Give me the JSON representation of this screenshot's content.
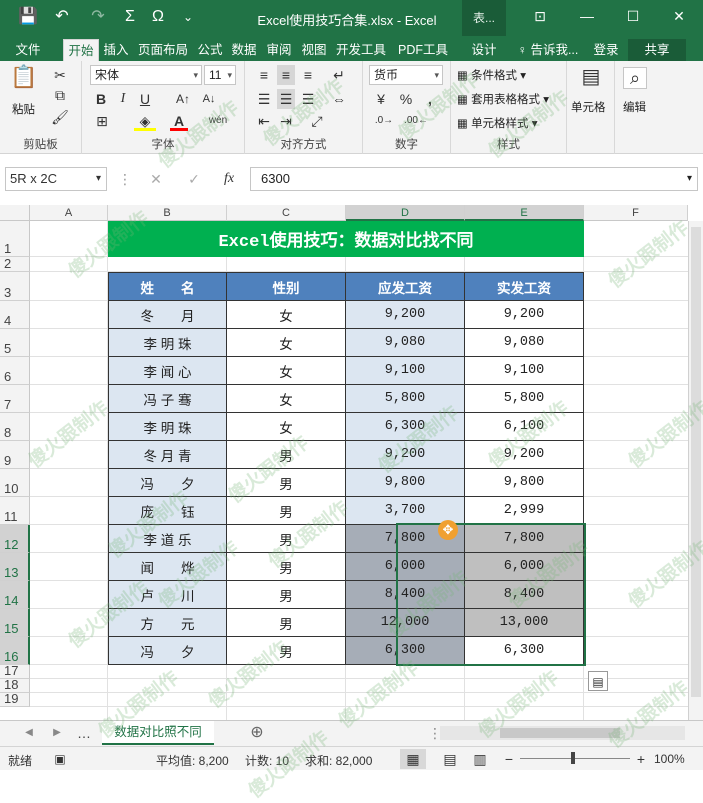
{
  "title_bar": {
    "window_title": "Excel使用技巧合集.xlsx - Excel",
    "context_tab": "表...",
    "qa_save": "💾",
    "qa_undo": "↶",
    "qa_redo": "↷",
    "qa_sum": "Σ",
    "qa_omega": "Ω",
    "qa_more": "⌄",
    "btn_ribbon_opts": "⊡",
    "btn_min": "—",
    "btn_max": "☐",
    "btn_close": "✕"
  },
  "tabs": [
    "文件",
    "开始",
    "插入",
    "页面布局",
    "公式",
    "数据",
    "审阅",
    "视图",
    "开发工具",
    "PDF工具集",
    "设计"
  ],
  "tell_me": "♀ 告诉我...",
  "login": "登录",
  "share": "共享",
  "ribbon": {
    "clipboard": {
      "paste": "粘贴",
      "label": "剪贴板"
    },
    "font": {
      "name": "宋体",
      "size": "11",
      "label": "字体",
      "bold": "B",
      "italic": "I",
      "underline": "U",
      "grow": "A↑",
      "shrink": "A↓",
      "wen": "wén"
    },
    "align": {
      "label": "对齐方式"
    },
    "number": {
      "format": "货币",
      "label": "数字",
      "percent": "%",
      "comma": ","
    },
    "styles": {
      "cond": "条件格式 ▾",
      "table": "套用表格格式 ▾",
      "cell": "单元格样式 ▾",
      "label": "样式"
    },
    "cells": {
      "label": "单元格"
    },
    "edit": {
      "label": "编辑"
    }
  },
  "formula_bar": {
    "name_box": "5R x 2C",
    "value": "6300",
    "fx": "fx"
  },
  "columns": [
    "A",
    "B",
    "C",
    "D",
    "E",
    "F"
  ],
  "rows": [
    "1",
    "2",
    "3",
    "4",
    "5",
    "6",
    "7",
    "8",
    "9",
    "10",
    "11",
    "12",
    "13",
    "14",
    "15",
    "16",
    "17",
    "18",
    "19"
  ],
  "sheet_title": "Excel使用技巧：数据对比找不同",
  "table": {
    "headers": [
      "姓　　名",
      "性别",
      "应发工资",
      "实发工资"
    ],
    "rows": [
      [
        "冬　　月",
        "女",
        "9,200",
        "9,200"
      ],
      [
        "李 明 珠",
        "女",
        "9,080",
        "9,080"
      ],
      [
        "李 闻 心",
        "女",
        "9,100",
        "9,100"
      ],
      [
        "冯 子 骞",
        "女",
        "5,800",
        "5,800"
      ],
      [
        "李 明 珠",
        "女",
        "6,300",
        "6,100"
      ],
      [
        "冬 月 青",
        "男",
        "9,200",
        "9,200"
      ],
      [
        "冯　　夕",
        "男",
        "9,800",
        "9,800"
      ],
      [
        "庞　　钰",
        "男",
        "3,700",
        "2,999"
      ],
      [
        "李 道 乐",
        "男",
        "7,800",
        "7,800"
      ],
      [
        "闻　　烨",
        "男",
        "6,000",
        "6,000"
      ],
      [
        "卢　　川",
        "男",
        "8,400",
        "8,400"
      ],
      [
        "方　　元",
        "男",
        "12,000",
        "13,000"
      ],
      [
        "冯　　夕",
        "男",
        "6,300",
        "6,300"
      ]
    ]
  },
  "sheet_tab": "数据对比照不同",
  "status": {
    "ready": "就绪",
    "average": "平均值: 8,200",
    "count": "计数: 10",
    "sum": "求和: 82,000",
    "zoom": "100%"
  },
  "watermark": "傻火跟制作",
  "colors": {
    "excel_green": "#217346",
    "banner_green": "#00b050",
    "header_blue": "#4f81bd",
    "light_blue": "#dce6f1",
    "selection": "#bfbfbf"
  }
}
